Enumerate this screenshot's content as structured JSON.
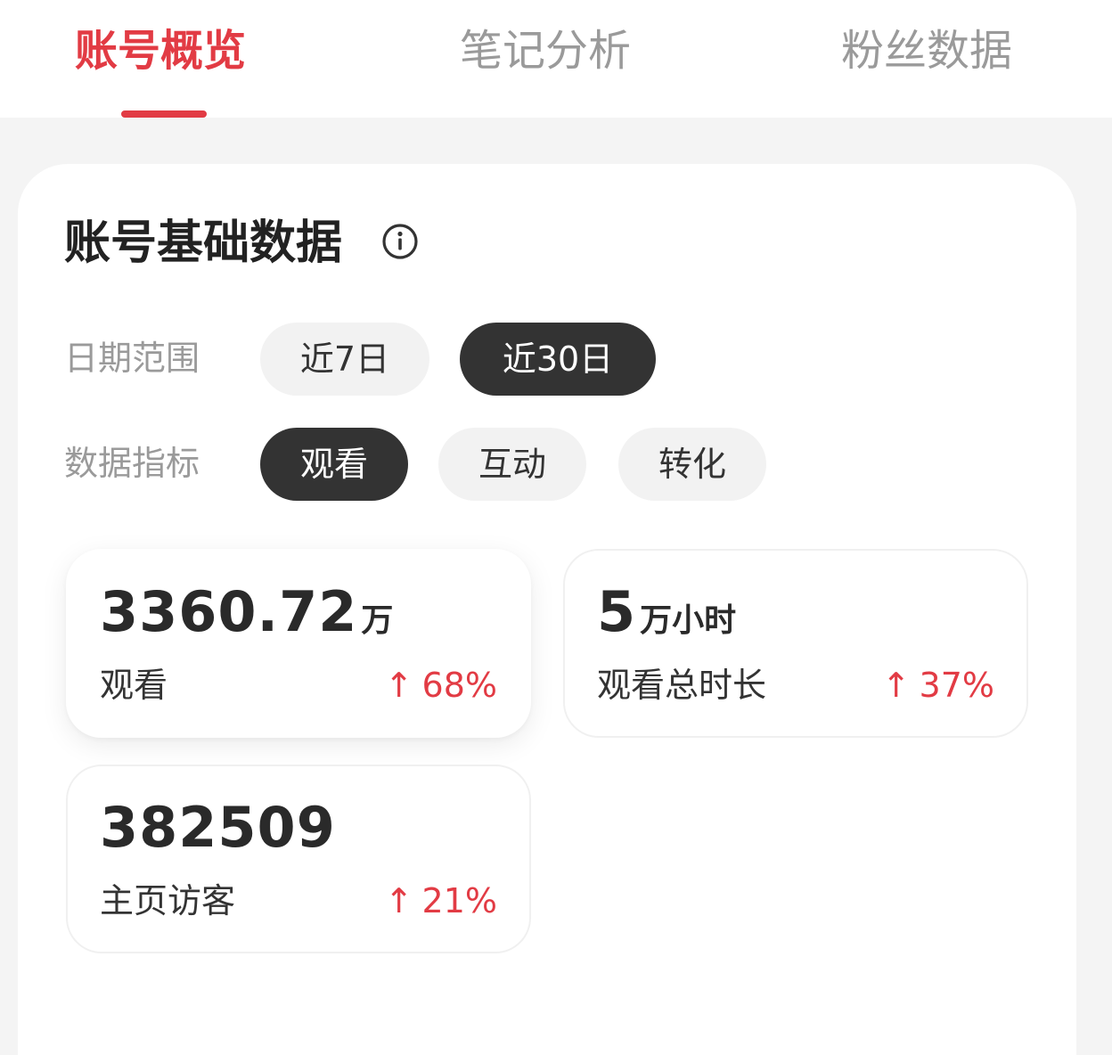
{
  "tabs": [
    {
      "label": "账号概览",
      "active": true
    },
    {
      "label": "笔记分析",
      "active": false
    },
    {
      "label": "粉丝数据",
      "active": false
    }
  ],
  "section": {
    "title": "账号基础数据",
    "info_icon": "info-circle-icon"
  },
  "filters": {
    "date_range": {
      "label": "日期范围",
      "options": [
        {
          "label": "近7日",
          "active": false
        },
        {
          "label": "近30日",
          "active": true
        }
      ]
    },
    "metric_type": {
      "label": "数据指标",
      "options": [
        {
          "label": "观看",
          "active": true
        },
        {
          "label": "互动",
          "active": false
        },
        {
          "label": "转化",
          "active": false
        }
      ]
    }
  },
  "metrics": [
    {
      "value": "3360.72",
      "unit": "万",
      "name": "观看",
      "arrow": "↑",
      "change": "68%",
      "selected": true
    },
    {
      "value": "5",
      "unit": "万小时",
      "name": "观看总时长",
      "arrow": "↑",
      "change": "37%",
      "selected": false
    },
    {
      "value": "382509",
      "unit": "",
      "name": "主页访客",
      "arrow": "↑",
      "change": "21%",
      "selected": false
    }
  ],
  "colors": {
    "accent": "#e23b44",
    "chip_active_bg": "#333333",
    "chip_bg": "#f2f2f2",
    "page_bg": "#f4f4f4"
  }
}
